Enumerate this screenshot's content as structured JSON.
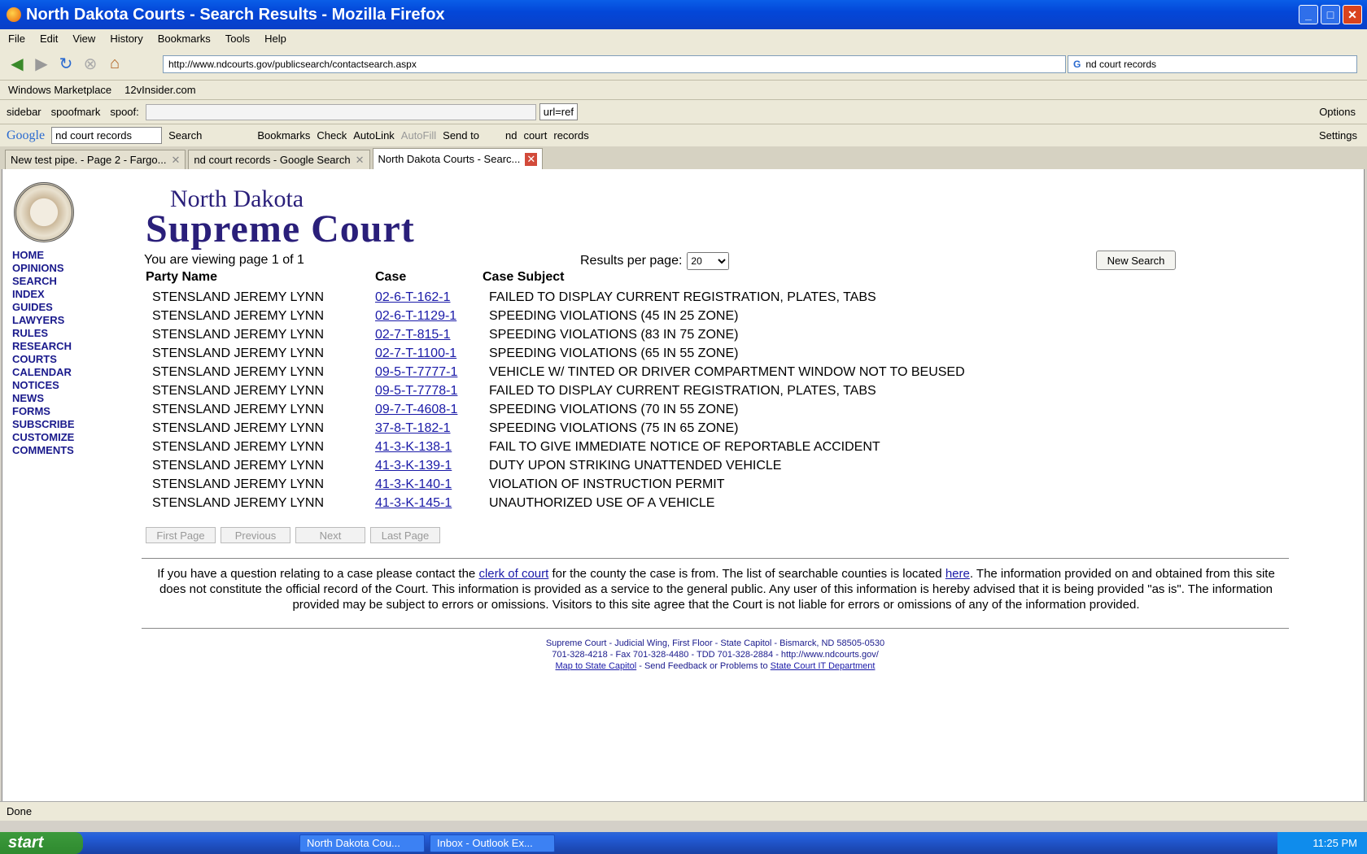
{
  "window": {
    "title": "North Dakota Courts - Search Results - Mozilla Firefox"
  },
  "menu": [
    "File",
    "Edit",
    "View",
    "History",
    "Bookmarks",
    "Tools",
    "Help"
  ],
  "nav": {
    "url": "http://www.ndcourts.gov/publicsearch/contactsearch.aspx",
    "search_value": "nd court records"
  },
  "bookmarks": [
    "Windows Marketplace",
    "12vInsider.com"
  ],
  "spoofbar": {
    "sidebar": "sidebar",
    "spoofmark": "spoofmark",
    "spoof_label": "spoof:",
    "url_field": "url=ref",
    "options": "Options"
  },
  "googlebar": {
    "brand": "Google",
    "query": "nd court records",
    "search": "Search",
    "bookmarks": "Bookmarks",
    "check": "Check",
    "autolink": "AutoLink",
    "autofill": "AutoFill",
    "sendto": "Send to",
    "term1": "nd",
    "term2": "court",
    "term3": "records",
    "settings": "Settings"
  },
  "tabs": [
    {
      "label": "New test pipe. - Page 2 - Fargo..."
    },
    {
      "label": "nd court records - Google Search"
    },
    {
      "label": "North Dakota Courts - Searc..."
    }
  ],
  "site": {
    "title_line1": "North Dakota",
    "title_line2": "Supreme Court"
  },
  "leftnav": [
    "HOME",
    "OPINIONS",
    "SEARCH",
    "INDEX",
    "GUIDES",
    "LAWYERS",
    "RULES",
    "RESEARCH",
    "COURTS",
    "CALENDAR",
    "NOTICES",
    "NEWS",
    "FORMS",
    "SUBSCRIBE",
    "CUSTOMIZE",
    "COMMENTS"
  ],
  "results": {
    "viewing": "You are viewing page 1 of 1",
    "per_page_label": "Results per page:",
    "per_page_value": "20",
    "new_search": "New Search",
    "headers": [
      "Party Name",
      "Case",
      "Case Subject"
    ],
    "rows": [
      [
        "STENSLAND JEREMY LYNN",
        "02-6-T-162-1",
        "FAILED TO DISPLAY CURRENT REGISTRATION, PLATES, TABS"
      ],
      [
        "STENSLAND JEREMY LYNN",
        "02-6-T-1129-1",
        "SPEEDING VIOLATIONS (45 IN 25 ZONE)"
      ],
      [
        "STENSLAND JEREMY LYNN",
        "02-7-T-815-1",
        "SPEEDING VIOLATIONS (83 IN 75 ZONE)"
      ],
      [
        "STENSLAND JEREMY LYNN",
        "02-7-T-1100-1",
        "SPEEDING VIOLATIONS (65 IN 55 ZONE)"
      ],
      [
        "STENSLAND JEREMY LYNN",
        "09-5-T-7777-1",
        "VEHICLE W/ TINTED OR DRIVER COMPARTMENT WINDOW NOT TO BEUSED"
      ],
      [
        "STENSLAND JEREMY LYNN",
        "09-5-T-7778-1",
        "FAILED TO DISPLAY CURRENT REGISTRATION, PLATES, TABS"
      ],
      [
        "STENSLAND JEREMY LYNN",
        "09-7-T-4608-1",
        "SPEEDING VIOLATIONS (70 IN 55 ZONE)"
      ],
      [
        "STENSLAND JEREMY LYNN",
        "37-8-T-182-1",
        "SPEEDING VIOLATIONS (75 IN 65 ZONE)"
      ],
      [
        "STENSLAND JEREMY LYNN",
        "41-3-K-138-1",
        "FAIL TO GIVE IMMEDIATE NOTICE OF REPORTABLE ACCIDENT"
      ],
      [
        "STENSLAND JEREMY LYNN",
        "41-3-K-139-1",
        "DUTY UPON STRIKING UNATTENDED VEHICLE"
      ],
      [
        "STENSLAND JEREMY LYNN",
        "41-3-K-140-1",
        "VIOLATION OF INSTRUCTION PERMIT"
      ],
      [
        "STENSLAND JEREMY LYNN",
        "41-3-K-145-1",
        "UNAUTHORIZED USE OF A VEHICLE"
      ]
    ],
    "pager": [
      "First Page",
      "Previous",
      "Next",
      "Last Page"
    ]
  },
  "notice": {
    "part1": "If you have a question relating to a case please contact the ",
    "link1": "clerk of court",
    "part2": " for the county the case is from. The list of searchable counties is located ",
    "link2": "here",
    "part3": ". The information provided on and obtained from this site does not constitute the official record of the Court. This information is provided as a service to the general public. Any user of this information is hereby advised that it is being provided \"as is\". The information provided may be subject to errors or omissions. Visitors to this site agree that the Court is not liable for errors or omissions of any of the information provided."
  },
  "footer": {
    "line1": "Supreme Court - Judicial Wing, First Floor - State Capitol - Bismarck, ND 58505-0530",
    "line2": "701-328-4218 - Fax 701-328-4480 - TDD 701-328-2884 - http://www.ndcourts.gov/",
    "map_link": "Map to State Capitol",
    "mid": " - Send Feedback or Problems to ",
    "it_link": "State Court IT Department"
  },
  "status": "Done",
  "taskbar": {
    "start": "start",
    "items": [
      "North Dakota Cou...",
      "Inbox - Outlook Ex..."
    ],
    "clock": "11:25 PM"
  }
}
